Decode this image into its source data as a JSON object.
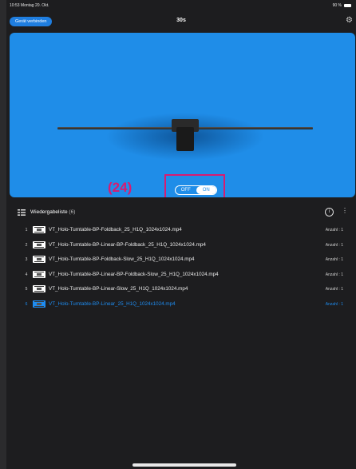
{
  "status": {
    "time": "10:53  Montag 20. Okt.",
    "battery": "90 %"
  },
  "topbar": {
    "connect_label": "Gerät verbinden",
    "title": "30s"
  },
  "preview": {
    "annotation": "(24)",
    "toggle_off": "OFF",
    "toggle_on": "ON",
    "toggle_state": "on"
  },
  "playlist": {
    "title": "Wiedergabeliste",
    "count": "(6)",
    "items": [
      {
        "index": "1",
        "name": "VT_Holo-Turntable-BP-Foldback_25_H1Q_1024x1024.mp4",
        "count": "Anzahl : 1"
      },
      {
        "index": "2",
        "name": "VT_Holo-Turntable-BP-Linear-BP-Foldback_25_H1Q_1024x1024.mp4",
        "count": "Anzahl : 1"
      },
      {
        "index": "3",
        "name": "VT_Holo-Turntable-BP-Foldback-Slow_25_H1Q_1024x1024.mp4",
        "count": "Anzahl : 1"
      },
      {
        "index": "4",
        "name": "VT_Holo-Turntable-BP-Linear-BP-Foldback-Slow_25_H1Q_1024x1024.mp4",
        "count": "Anzahl : 1"
      },
      {
        "index": "5",
        "name": "VT_Holo-Turntable-BP-Linear-Slow_25_H1Q_1024x1024.mp4",
        "count": "Anzahl : 1"
      },
      {
        "index": "6",
        "name": "VT_Holo-Turntable-BP-Linear_25_H1Q_1024x1024.mp4",
        "count": "Anzahl : 1"
      }
    ]
  },
  "colors": {
    "accent": "#1f8de8",
    "annotation": "#d81b71",
    "background": "#1d1d1f"
  },
  "icons": {
    "settings": "gear-icon",
    "playlist": "playlist-icon",
    "info": "info-icon",
    "more": "more-icon"
  }
}
